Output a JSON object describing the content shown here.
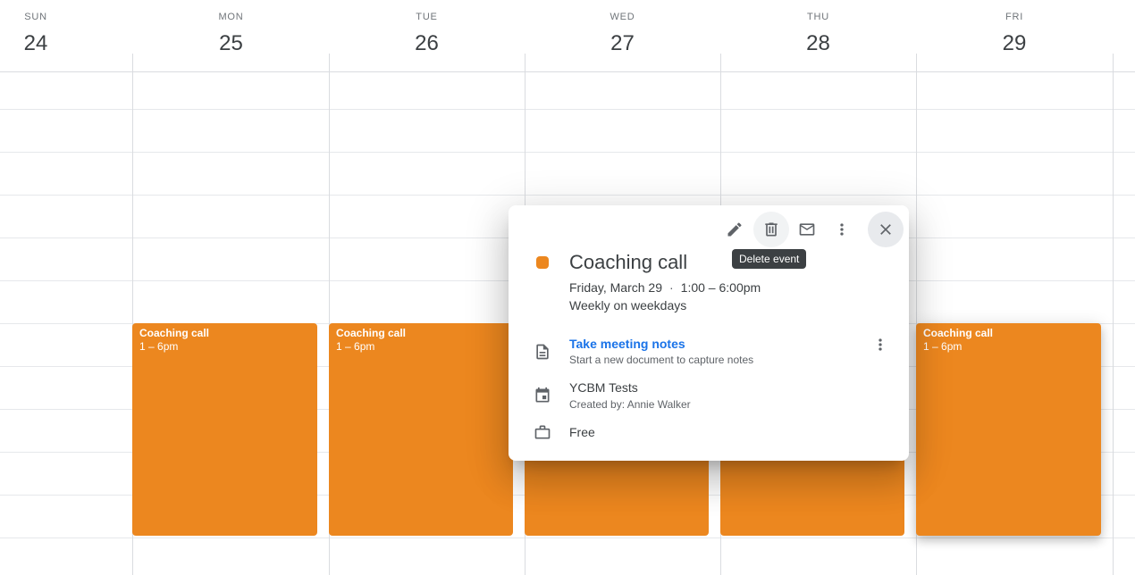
{
  "days": [
    {
      "dow": "SUN",
      "date": "24"
    },
    {
      "dow": "MON",
      "date": "25"
    },
    {
      "dow": "TUE",
      "date": "26"
    },
    {
      "dow": "WED",
      "date": "27"
    },
    {
      "dow": "THU",
      "date": "28"
    },
    {
      "dow": "FRI",
      "date": "29"
    }
  ],
  "events": [
    {
      "title": "Coaching call",
      "time": "1 – 6pm"
    },
    {
      "title": "Coaching call",
      "time": "1 – 6pm"
    },
    {
      "title": "Coaching call",
      "time": "1 – 6pm"
    }
  ],
  "colors": {
    "event": "#ec871f",
    "link": "#1a73e8",
    "tooltip_bg": "#3c4043"
  },
  "popup": {
    "toolbar": {
      "edit_icon": "pencil-icon",
      "delete_icon": "trash-icon",
      "email_icon": "mail-icon",
      "options_icon": "more-vert-icon",
      "close_icon": "close-icon"
    },
    "tooltip": "Delete event",
    "title": "Coaching call",
    "date": "Friday, March 29",
    "separator": "·",
    "time": "1:00 – 6:00pm",
    "recurrence": "Weekly on weekdays",
    "notes": {
      "link": "Take meeting notes",
      "description": "Start a new document to capture notes"
    },
    "calendar": {
      "name": "YCBM Tests",
      "created_by": "Created by: Annie Walker"
    },
    "availability": "Free"
  }
}
